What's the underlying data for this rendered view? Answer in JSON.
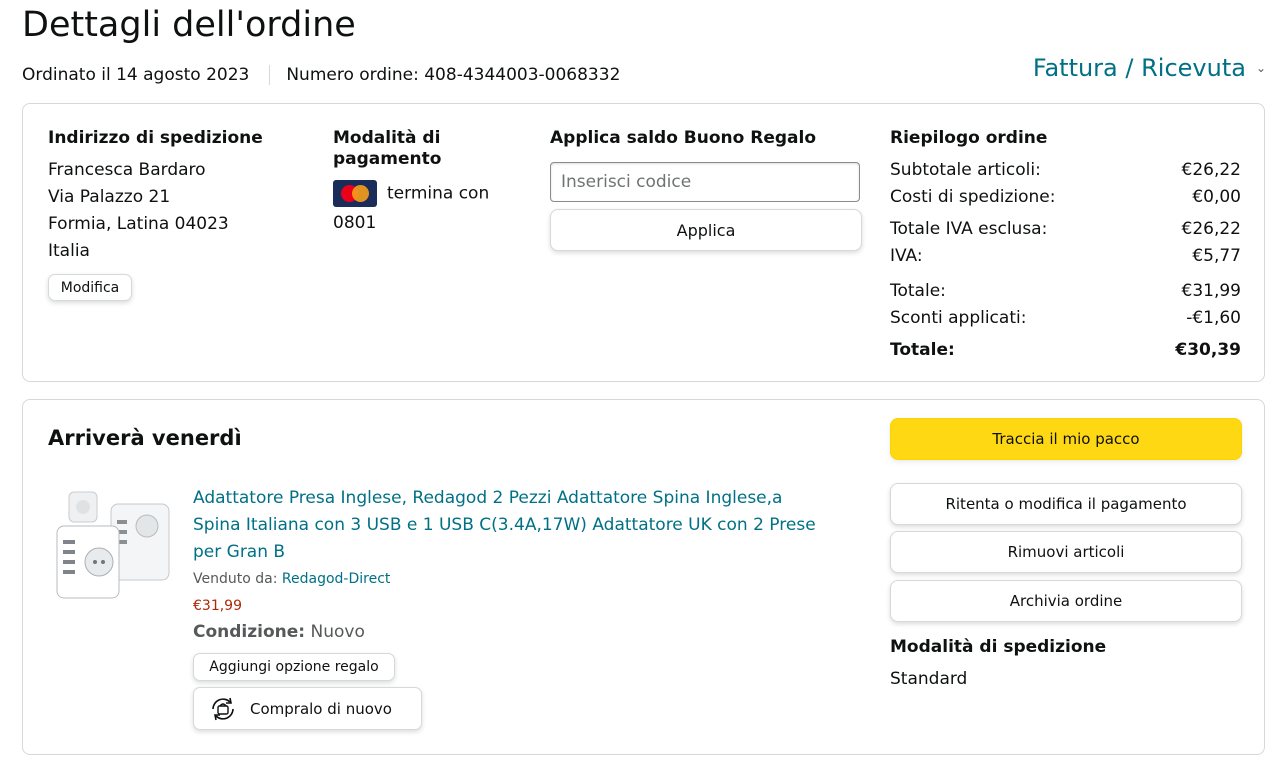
{
  "page": {
    "title": "Dettagli dell'ordine",
    "ordered_on": "Ordinato il 14 agosto 2023",
    "order_number": "Numero ordine: 408-4344003-0068332",
    "invoice_label": "Fattura / Ricevuta"
  },
  "shipping_address": {
    "title": "Indirizzo di spedizione",
    "lines": [
      "Francesca Bardaro",
      "Via Palazzo 21",
      "Formia, Latina 04023",
      "Italia"
    ],
    "edit_label": "Modifica"
  },
  "payment": {
    "title_line1": "Modalità di",
    "title_line2": "pagamento",
    "card_icon": "mastercard-icon",
    "card_text": "termina con",
    "card_digits": "0801"
  },
  "gift_card": {
    "title": "Applica saldo Buono Regalo",
    "placeholder": "Inserisci codice",
    "apply_label": "Applica"
  },
  "summary": {
    "title": "Riepilogo ordine",
    "rows": [
      {
        "label": "Subtotale articoli:",
        "value": "€26,22"
      },
      {
        "label": "Costi di spedizione:",
        "value": "€0,00"
      },
      {
        "label": "Totale IVA esclusa:",
        "value": "€26,22"
      },
      {
        "label": "IVA:",
        "value": "€5,77"
      },
      {
        "label": "Totale:",
        "value": "€31,99"
      },
      {
        "label": "Sconti applicati:",
        "value": "-€1,60"
      },
      {
        "label": "Totale:",
        "value": "€30,39"
      }
    ]
  },
  "shipment": {
    "title": "Arriverà venerdì",
    "product_title_lines": [
      "Adattatore Presa Inglese, Redagod 2 Pezzi Adattatore Spina Inglese,a",
      "Spina Italiana con 3 USB e 1 USB C(3.4A,17W) Adattatore UK con 2 Prese",
      "per Gran B"
    ],
    "sold_by_label": "Venduto da:",
    "seller": "Redagod-Direct",
    "price": "€31,99",
    "condition_label": "Condizione:",
    "condition_value": "Nuovo",
    "gift_option_label": "Aggiungi opzione regalo",
    "buy_again_label": "Compralo di nuovo",
    "buy_again_icon": "reorder-icon",
    "track_label": "Traccia il mio pacco",
    "retry_payment_label": "Ritenta o modifica il pagamento",
    "remove_items_label": "Rimuovi articoli",
    "archive_label": "Archivia ordine",
    "shipping_method_title": "Modalità di spedizione",
    "shipping_method_value": "Standard"
  },
  "colors": {
    "link": "#007185",
    "price": "#b12704",
    "primary_button": "#ffd814",
    "border": "#d5d9d9"
  }
}
